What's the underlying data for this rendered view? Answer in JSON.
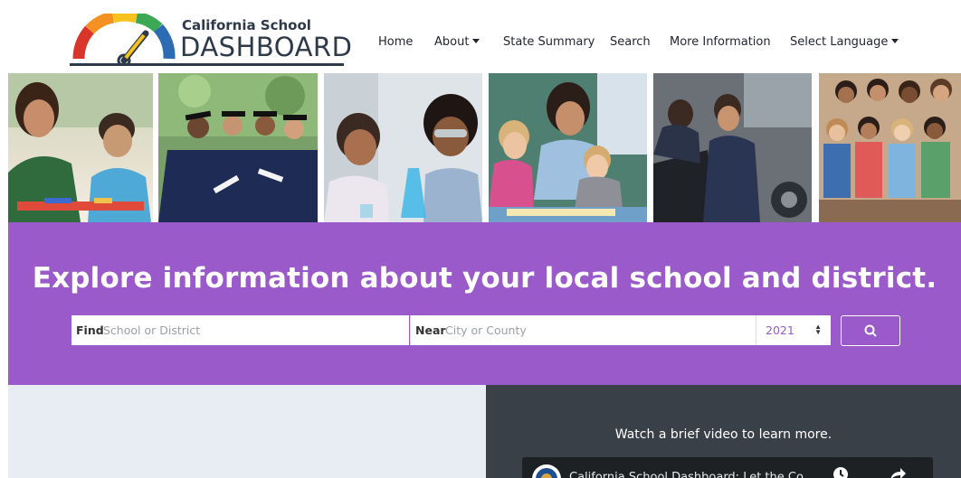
{
  "header": {
    "logo_top": "California School",
    "logo_main": "DASHBOARD",
    "nav": {
      "home": "Home",
      "about": "About",
      "state_summary": "State Summary",
      "search": "Search",
      "more_info": "More Information",
      "select_language": "Select Language"
    }
  },
  "hero": {
    "title": "Explore information about your local school and district.",
    "find_label": "Find",
    "find_placeholder": "School or District",
    "near_label": "Near",
    "near_placeholder": "City or County",
    "year": "2021",
    "search_icon": "search-icon"
  },
  "video": {
    "heading": "Watch a brief video to learn more.",
    "title": "California School Dashboard: Let the Co..."
  },
  "colors": {
    "hero_bg": "#9a5ac9",
    "dark_panel": "#3a4048",
    "light_panel": "#e8edf3",
    "navy": "#2e3a4a"
  }
}
